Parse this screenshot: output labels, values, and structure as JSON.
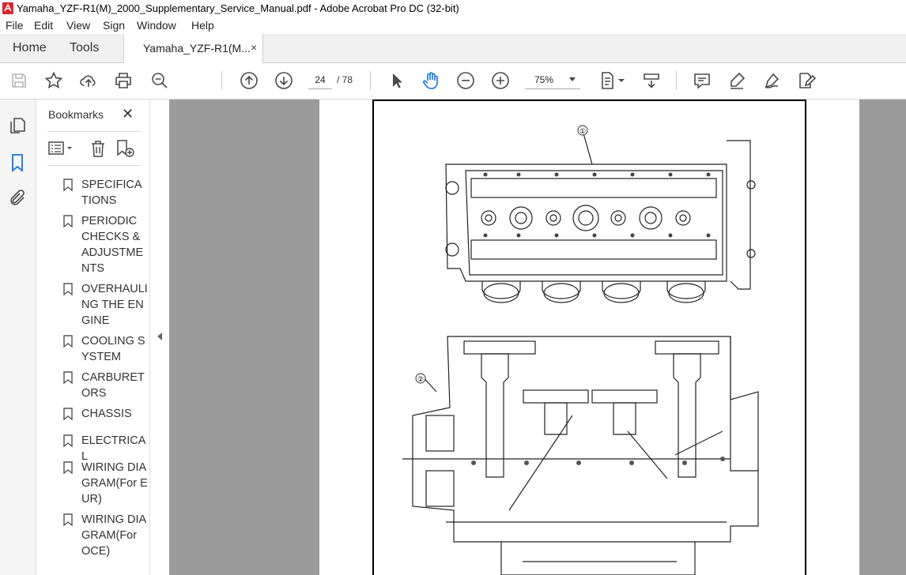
{
  "window": {
    "title": "Yamaha_YZF-R1(M)_2000_Supplementary_Service_Manual.pdf - Adobe Acrobat Pro DC (32-bit)"
  },
  "menu": [
    "File",
    "Edit",
    "View",
    "Sign",
    "Window",
    "Help"
  ],
  "tabs": {
    "home": "Home",
    "tools": "Tools",
    "document": "Yamaha_YZF-R1(M...",
    "close": "×"
  },
  "toolbar": {
    "current_page": "24",
    "total_pages": "/ 78",
    "zoom": "75%"
  },
  "bookmarks": {
    "title": "Bookmarks",
    "close": "✕",
    "items": [
      {
        "label": "SPECIFICATIONS"
      },
      {
        "label": "PERIODIC CHECKS & ADJUSTMENTS"
      },
      {
        "label": "OVERHAULING THE ENGINE"
      },
      {
        "label": "COOLING SYSTEM"
      },
      {
        "label": "CARBURETORS"
      },
      {
        "label": "CHASSIS"
      },
      {
        "label": "ELECTRICAL"
      },
      {
        "label": "WIRING DIAGRAM(For EUR)"
      },
      {
        "label": "WIRING DIAGRAM(For OCE)"
      }
    ]
  },
  "document": {
    "callout_1": "①",
    "callout_2": "②"
  },
  "colors": {
    "accent": "#1473e6",
    "doc_background": "#9b9b9b",
    "pdf_icon": "#d7282f"
  }
}
